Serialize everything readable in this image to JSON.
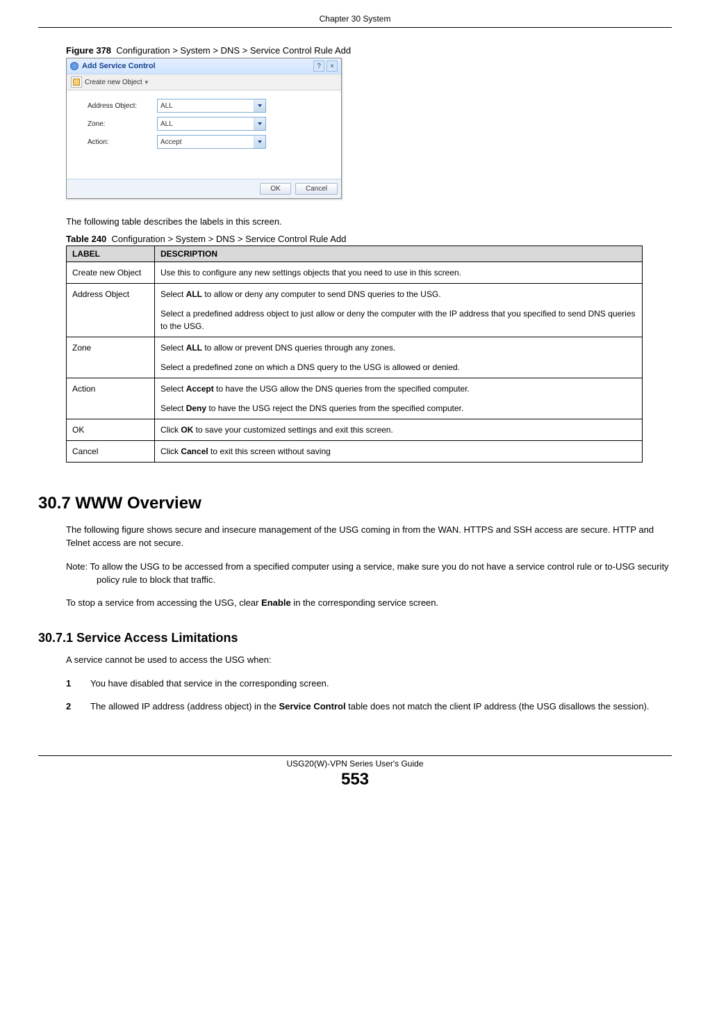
{
  "header": {
    "chapter": "Chapter 30 System"
  },
  "figure": {
    "label": "Figure 378",
    "caption": "Configuration > System > DNS > Service Control Rule Add",
    "dialog": {
      "title": "Add Service Control",
      "create_obj": "Create new Object",
      "fields": {
        "address_label": "Address Object:",
        "address_value": "ALL",
        "zone_label": "Zone:",
        "zone_value": "ALL",
        "action_label": "Action:",
        "action_value": "Accept"
      },
      "ok": "OK",
      "cancel": "Cancel"
    }
  },
  "intro": "The following table describes the labels in this screen.",
  "table": {
    "label": "Table 240",
    "caption": "Configuration > System > DNS > Service Control Rule Add",
    "head_label": "LABEL",
    "head_desc": "DESCRIPTION",
    "rows": {
      "create": {
        "l": "Create new Object",
        "d": "Use this to configure any new settings objects that you need to use in this screen."
      },
      "addr": {
        "l": "Address Object",
        "d1a": "Select ",
        "d1b": "ALL",
        "d1c": " to allow or deny any computer to send DNS queries to the USG.",
        "d2": "Select a predefined address object to just allow or deny the computer with the IP address that you specified to send DNS queries to the USG."
      },
      "zone": {
        "l": "Zone",
        "d1a": "Select ",
        "d1b": "ALL",
        "d1c": " to allow or prevent DNS queries through any zones.",
        "d2": "Select a predefined zone on which a DNS query to the USG is allowed or denied."
      },
      "action": {
        "l": "Action",
        "d1a": "Select ",
        "d1b": "Accept",
        "d1c": " to have the USG allow the DNS queries from the specified computer.",
        "d2a": "Select ",
        "d2b": "Deny",
        "d2c": " to have the USG reject the DNS queries from the specified computer."
      },
      "ok": {
        "l": "OK",
        "d1a": "Click ",
        "d1b": "OK",
        "d1c": " to save your customized settings and exit this screen."
      },
      "cancel": {
        "l": "Cancel",
        "d1a": "Click ",
        "d1b": "Cancel",
        "d1c": " to exit this screen without saving"
      }
    }
  },
  "sec307": {
    "title": "30.7  WWW Overview",
    "p1": "The following figure shows secure and insecure management of the USG coming in from the WAN. HTTPS and SSH access are secure. HTTP and Telnet access are not secure.",
    "note": "Note: To allow the USG to be accessed from a specified computer using a service, make sure you do not have a service control rule or to-USG security policy rule to block that traffic.",
    "p2a": "To stop a service from accessing the USG, clear ",
    "p2b": "Enable",
    "p2c": " in the corresponding service screen."
  },
  "sec3071": {
    "title": "30.7.1  Service Access Limitations",
    "intro": "A service cannot be used to access the USG when:",
    "i1n": "1",
    "i1t": "You have disabled that service in the corresponding screen.",
    "i2n": "2",
    "i2ta": "The allowed IP address (address object) in the ",
    "i2tb": "Service Control",
    "i2tc": " table does not match the client IP address (the USG disallows the session)."
  },
  "footer": {
    "guide": "USG20(W)-VPN Series User's Guide",
    "page": "553"
  }
}
